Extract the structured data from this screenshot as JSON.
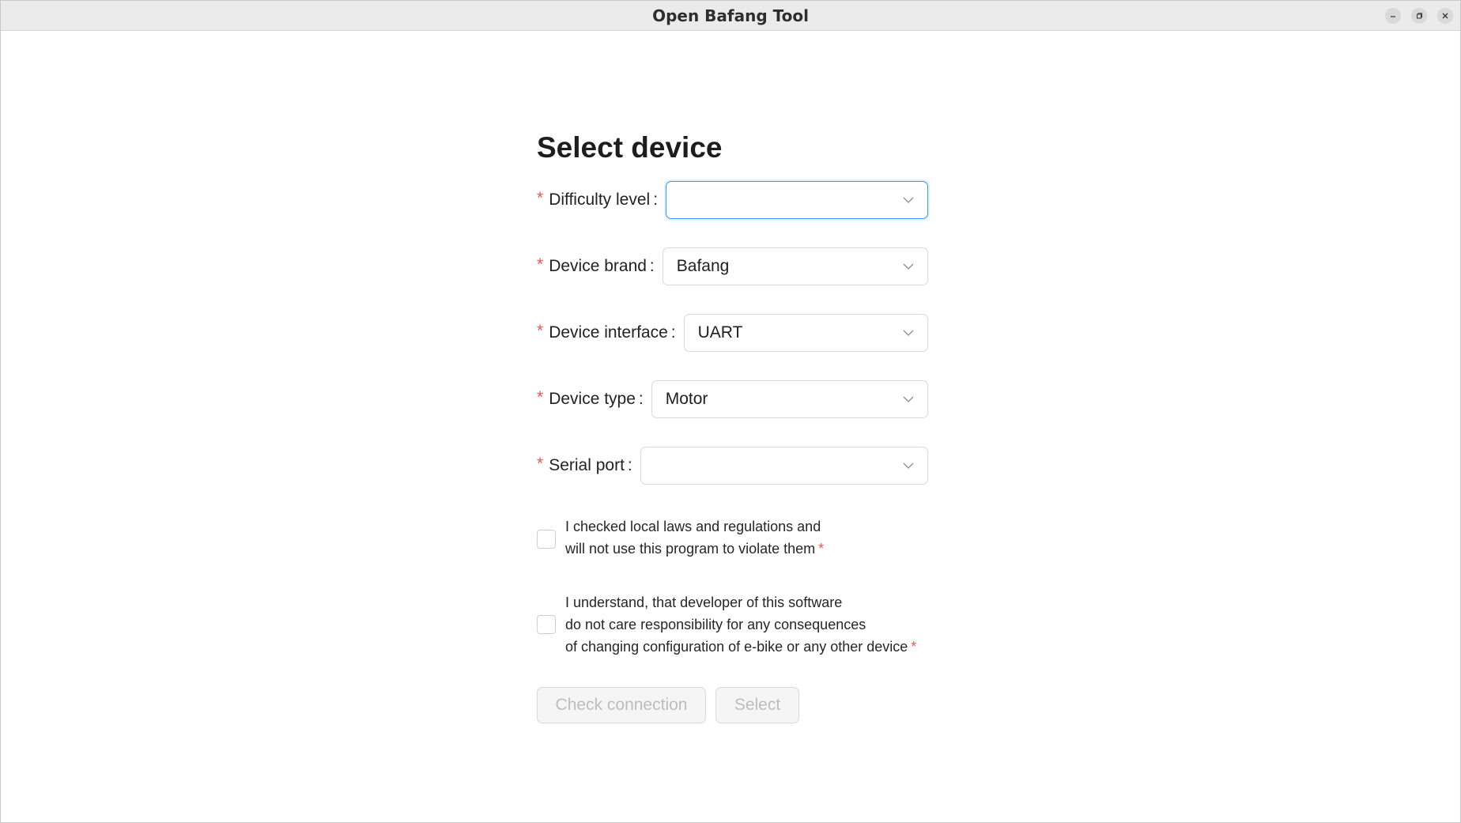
{
  "window": {
    "title": "Open Bafang Tool",
    "controls": {
      "minimize": "–",
      "maximize": "▫",
      "close": "✕"
    }
  },
  "form": {
    "heading": "Select device",
    "fields": [
      {
        "label": "Difficulty level",
        "value": "",
        "required": true,
        "focused": true
      },
      {
        "label": "Device brand",
        "value": "Bafang",
        "required": true
      },
      {
        "label": "Device interface",
        "value": "UART",
        "required": true
      },
      {
        "label": "Device type",
        "value": "Motor",
        "required": true
      },
      {
        "label": "Serial port",
        "value": "",
        "required": true
      }
    ],
    "required_mark": "*",
    "colon": ":",
    "checkboxes": [
      {
        "lines": [
          "I checked local laws and regulations and",
          "will not use this program to violate them"
        ],
        "checked": false
      },
      {
        "lines": [
          "I understand, that developer of this software",
          "do not care responsibility for any consequences",
          "of changing configuration of e-bike or any other device"
        ],
        "checked": false
      }
    ],
    "buttons": {
      "check_connection": "Check connection",
      "select": "Select"
    }
  },
  "colors": {
    "required": "#ff4d4f",
    "focus": "#4096ff",
    "disabled_text": "#bdbdbd"
  }
}
